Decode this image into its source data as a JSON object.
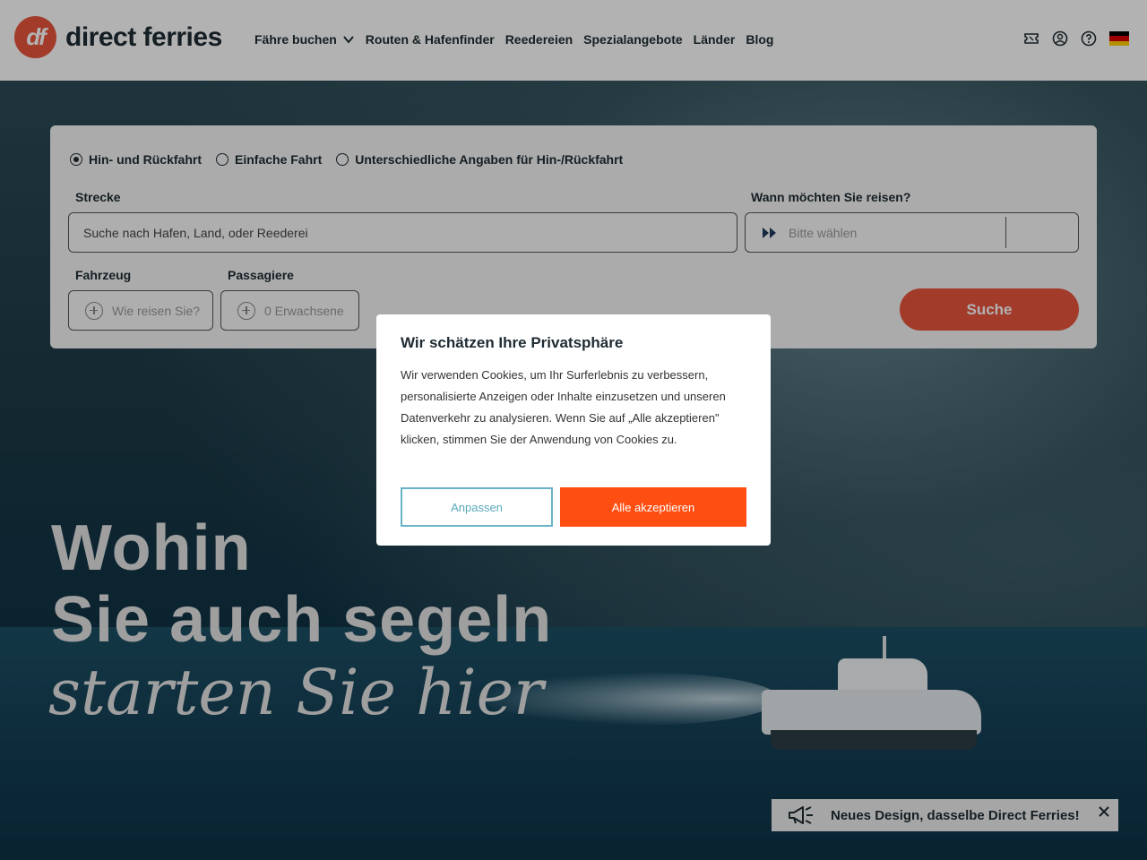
{
  "brand": {
    "logo_mark": "df",
    "name": "direct ferries",
    "color": "#e8553d"
  },
  "nav": {
    "items": [
      {
        "label": "Fähre buchen",
        "dropdown": true
      },
      {
        "label": "Routen & Hafenfinder"
      },
      {
        "label": "Reedereien"
      },
      {
        "label": "Spezialangebote"
      },
      {
        "label": "Länder"
      },
      {
        "label": "Blog"
      }
    ]
  },
  "header_icons": [
    "ticket-icon",
    "account-icon",
    "help-icon",
    "german-flag-icon"
  ],
  "booking": {
    "trip_types": [
      {
        "label": "Hin- und Rückfahrt",
        "selected": true
      },
      {
        "label": "Einfache Fahrt",
        "selected": false
      },
      {
        "label": "Unterschiedliche Angaben für Hin-/Rückfahrt",
        "selected": false
      }
    ],
    "route_label": "Strecke",
    "route_placeholder": "Suche nach Hafen, Land, oder Reederei",
    "date_label": "Wann möchten Sie reisen?",
    "date_placeholder": "Bitte wählen",
    "vehicle_label": "Fahrzeug",
    "vehicle_placeholder": "Wie reisen Sie?",
    "passengers_label": "Passagiere",
    "passengers_placeholder": "0 Erwachsene",
    "search_button": "Suche",
    "accent_color": "#e8553d"
  },
  "hero": {
    "line1": "Wohin",
    "line2": "Sie auch segeln",
    "line3": "starten Sie hier"
  },
  "cookie_modal": {
    "title": "Wir schätzen Ihre Privatsphäre",
    "text": "Wir verwenden Cookies, um Ihr Surferlebnis zu verbessern, personalisierte Anzeigen oder Inhalte einzusetzen und unseren Datenverkehr zu analysieren. Wenn Sie auf „Alle akzeptieren\" klicken, stimmen Sie der Anwendung von Cookies zu.",
    "customize_button": "Anpassen",
    "accept_button": "Alle akzeptieren",
    "accept_color": "#ff4e12"
  },
  "toast": {
    "text": "Neues Design, dasselbe Direct Ferries!",
    "icon": "megaphone-icon"
  }
}
